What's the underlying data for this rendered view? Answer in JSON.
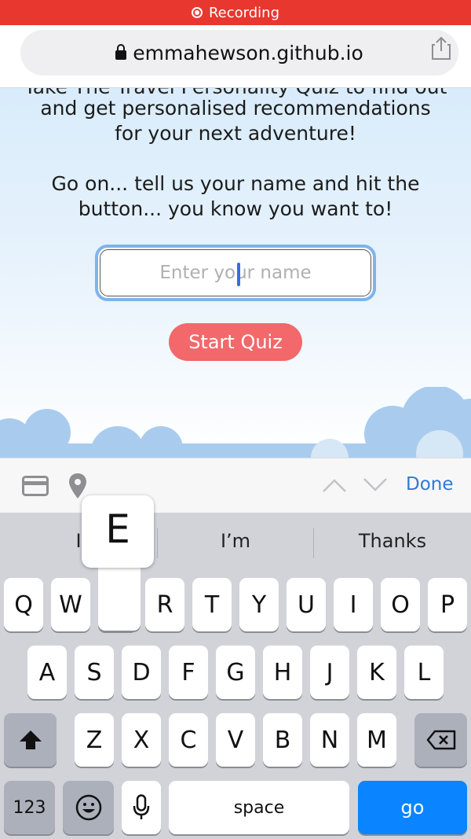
{
  "status_bar": {
    "recording_label": "Recording",
    "color": "#e8372f"
  },
  "browser": {
    "url": "emmahewson.github.io",
    "lock_icon": "lock-icon",
    "share_icon": "share-icon"
  },
  "page": {
    "clipped_line": "Take The Travel Personality Quiz to find out",
    "intro_lines": [
      "and get personalised recommendations",
      "for your next adventure!"
    ],
    "prompt": "Go on... tell us your name and hit the button... you know you want to!",
    "name_input": {
      "placeholder": "Enter your name",
      "value": ""
    },
    "start_button": "Start Quiz",
    "accent": "#f2686b"
  },
  "accessory_bar": {
    "done_label": "Done",
    "icons": [
      "credit-card-icon",
      "location-pin-icon",
      "chevron-up-icon",
      "chevron-down-icon"
    ]
  },
  "keyboard": {
    "suggestions": [
      "I",
      "I’m",
      "Thanks"
    ],
    "rows": [
      [
        "Q",
        "W",
        "E",
        "R",
        "T",
        "Y",
        "U",
        "I",
        "O",
        "P"
      ],
      [
        "A",
        "S",
        "D",
        "F",
        "G",
        "H",
        "J",
        "K",
        "L"
      ],
      [
        "Z",
        "X",
        "C",
        "V",
        "B",
        "N",
        "M"
      ]
    ],
    "numbers_label": "123",
    "space_label": "space",
    "go_label": "go",
    "pressed_key": "E",
    "go_color": "#0a84ff"
  }
}
